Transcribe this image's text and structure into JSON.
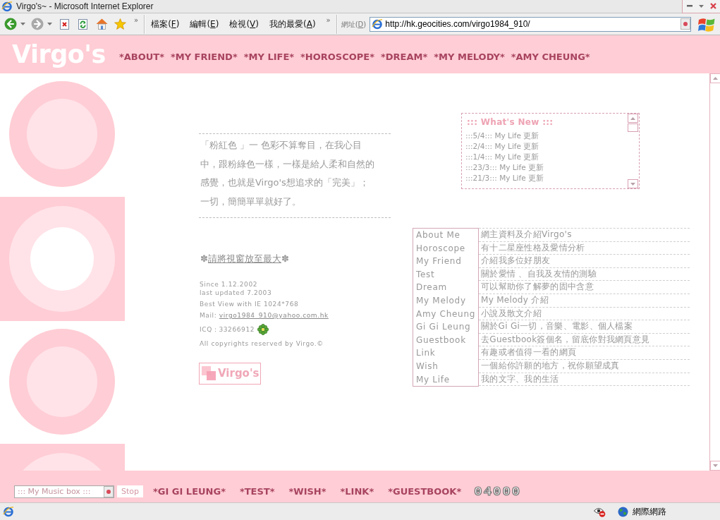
{
  "window": {
    "title": "Virgo's~ - Microsoft Internet Explorer"
  },
  "toolbar": {
    "chevron": "»"
  },
  "menu": {
    "items": [
      {
        "label": "檔案(",
        "key": "F",
        "tail": ")"
      },
      {
        "label": "編輯(",
        "key": "E",
        "tail": ")"
      },
      {
        "label": "檢視(",
        "key": "V",
        "tail": ")"
      },
      {
        "label": "我的最愛(",
        "key": "A",
        "tail": ")"
      }
    ],
    "chevron": "»"
  },
  "address": {
    "label": "網址(",
    "key": "D",
    "tail": ")",
    "url": "http://hk.geocities.com/virgo1984_910/"
  },
  "header": {
    "logo": "Virgo's",
    "nav": [
      "*ABOUT*",
      "*MY FRIEND*",
      "*MY LIFE*",
      "*HOROSCOPE*",
      "*DREAM*",
      "*MY MELODY*",
      "*AMY CHEUNG*"
    ]
  },
  "intro": {
    "paragraph": "「粉紅色 」一 色彩不算奪目，在我心目中，跟粉綠色一樣，一樣是給人柔和自然的感覺，也就是Virgo's想追求的「完美」；一切，簡簡單單就好了。"
  },
  "notice": {
    "prefix": "✽",
    "link": "請將視窗放至最大",
    "suffix": "✽"
  },
  "info": {
    "since": "Since 1.12.2002",
    "updated": "last updated 7.2003",
    "best_view": "Best View with IE 1024*768",
    "mail_label": "Mail:",
    "mail": "virgo1984_910@yahoo.com.hk",
    "icq": "ICQ：33266912",
    "copyright": "All copyrights reserved by Virgo.©"
  },
  "banner": {
    "label": "Virgo's"
  },
  "whats_new": {
    "title": "::: What's New :::",
    "items": [
      ":::5/4::: My Life 更新",
      ":::2/4::: My Life 更新",
      ":::1/4::: My Life 更新",
      ":::23/3::: My Life 更新",
      ":::21/3::: My Life 更新"
    ]
  },
  "sections": [
    {
      "name": "About Me",
      "description": "網主資料及介紹Virgo's"
    },
    {
      "name": "Horoscope",
      "description": "有十二星座性格及愛情分析"
    },
    {
      "name": "My Friend",
      "description": "介紹我多位好朋友"
    },
    {
      "name": "Test",
      "description": "關於愛情 、自我及友情的測驗"
    },
    {
      "name": "Dream",
      "description": "可以幫助你了解夢的固中含意"
    },
    {
      "name": "My Melody",
      "description": "My Melody 介紹"
    },
    {
      "name": "Amy Cheung",
      "description": "小說及散文介紹"
    },
    {
      "name": "Gi Gi Leung",
      "description": "關於Gi Gi一切，音樂、電影、個人檔案"
    },
    {
      "name": "Guestbook",
      "description": "去Guestbook簽個名，留底你對我網頁意見"
    },
    {
      "name": "Link",
      "description": "有趣或者值得一看的網頁"
    },
    {
      "name": "Wish",
      "description": "一個給你許願的地方，祝你願望成真"
    },
    {
      "name": "My Life",
      "description": "我的文字、我的生活"
    }
  ],
  "bottom_bar": {
    "music_box": "::: My Music box :::",
    "stop": "Stop",
    "nav": [
      "*GI GI LEUNG*",
      "*TEST*",
      "*WISH*",
      "*LINK*",
      "*GUESTBOOK*"
    ],
    "counter": "04000"
  },
  "status_bar": {
    "zone": "網際網路"
  }
}
